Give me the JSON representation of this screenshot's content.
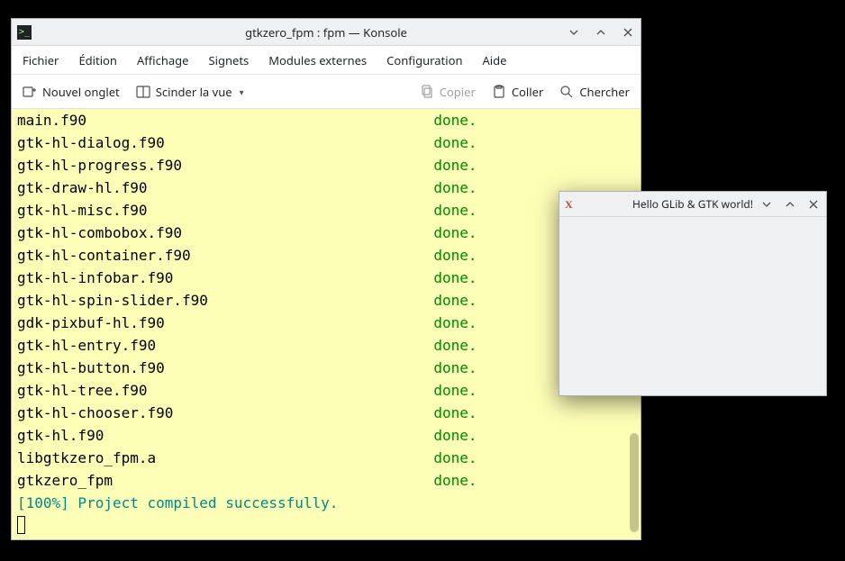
{
  "konsole": {
    "title": "gtkzero_fpm : fpm — Konsole",
    "menu": [
      "Fichier",
      "Édition",
      "Affichage",
      "Signets",
      "Modules externes",
      "Configuration",
      "Aide"
    ],
    "toolbar": {
      "new_tab": "Nouvel onglet",
      "split_view": "Scinder la vue",
      "copy": "Copier",
      "paste": "Coller",
      "search": "Chercher"
    },
    "terminal_lines": [
      {
        "file": "main.f90",
        "status": "done."
      },
      {
        "file": "gtk-hl-dialog.f90",
        "status": "done."
      },
      {
        "file": "gtk-hl-progress.f90",
        "status": "done."
      },
      {
        "file": "gtk-draw-hl.f90",
        "status": "done."
      },
      {
        "file": "gtk-hl-misc.f90",
        "status": "done."
      },
      {
        "file": "gtk-hl-combobox.f90",
        "status": "done."
      },
      {
        "file": "gtk-hl-container.f90",
        "status": "done."
      },
      {
        "file": "gtk-hl-infobar.f90",
        "status": "done."
      },
      {
        "file": "gtk-hl-spin-slider.f90",
        "status": "done."
      },
      {
        "file": "gdk-pixbuf-hl.f90",
        "status": "done."
      },
      {
        "file": "gtk-hl-entry.f90",
        "status": "done."
      },
      {
        "file": "gtk-hl-button.f90",
        "status": "done."
      },
      {
        "file": "gtk-hl-tree.f90",
        "status": "done."
      },
      {
        "file": "gtk-hl-chooser.f90",
        "status": "done."
      },
      {
        "file": "gtk-hl.f90",
        "status": "done."
      },
      {
        "file": "libgtkzero_fpm.a",
        "status": "done."
      },
      {
        "file": "gtkzero_fpm",
        "status": "done."
      }
    ],
    "progress_line": "[100%] Project compiled successfully."
  },
  "gtk_window": {
    "title": "Hello GLib & GTK world!"
  }
}
